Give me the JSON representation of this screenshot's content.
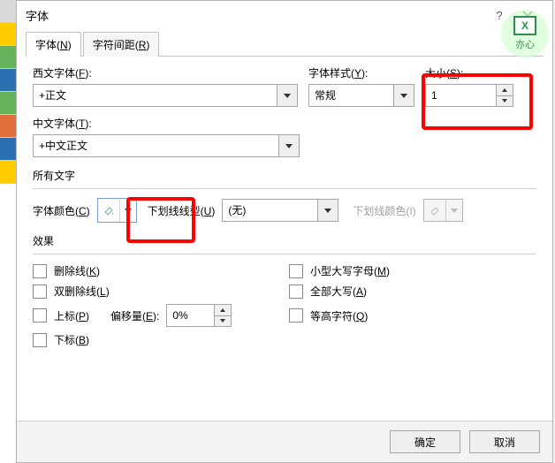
{
  "title": "字体",
  "tabs": [
    {
      "label": "字体",
      "mnemonic": "N"
    },
    {
      "label": "字符间距",
      "mnemonic": "R"
    }
  ],
  "fields": {
    "westernFontLabel": "西文字体(",
    "westernFontMn": "F",
    "westernFontLabel2": "):",
    "westernFontValue": "+正文",
    "fontStyleLabel": "字体样式(",
    "fontStyleMn": "Y",
    "fontStyleLabel2": "):",
    "fontStyleValue": "常规",
    "sizeLabel": "大小(",
    "sizeMn": "S",
    "sizeLabel2": "):",
    "sizeValue": "1",
    "chineseFontLabel": "中文字体(",
    "chineseFontMn": "T",
    "chineseFontLabel2": "):",
    "chineseFontValue": "+中文正文"
  },
  "allText": {
    "label": "所有文字",
    "fontColorLabel": "字体颜色(",
    "fontColorMn": "C",
    "fontColorLabel2": ")",
    "underlineTypeLabel": "下划线线型(",
    "underlineTypeMn": "U",
    "underlineTypeLabel2": ")",
    "underlineTypeValue": "(无)",
    "underlineColorLabel": "下划线颜色(I)"
  },
  "effects": {
    "label": "效果",
    "strikethrough": {
      "label": "删除线",
      "mn": "K"
    },
    "doubleStrike": {
      "label": "双删除线",
      "mn": "L"
    },
    "superscript": {
      "label": "上标",
      "mn": "P"
    },
    "subscript": {
      "label": "下标",
      "mn": "B"
    },
    "offsetLabel": "偏移量(",
    "offsetMn": "E",
    "offsetLabel2": "):",
    "offsetValue": "0%",
    "smallCaps": {
      "label": "小型大写字母",
      "mn": "M"
    },
    "allCaps": {
      "label": "全部大写",
      "mn": "A"
    },
    "equalHeight": {
      "label": "等高字符",
      "mn": "Q"
    }
  },
  "buttons": {
    "ok": "确定",
    "cancel": "取消"
  },
  "watermark": "亦心"
}
